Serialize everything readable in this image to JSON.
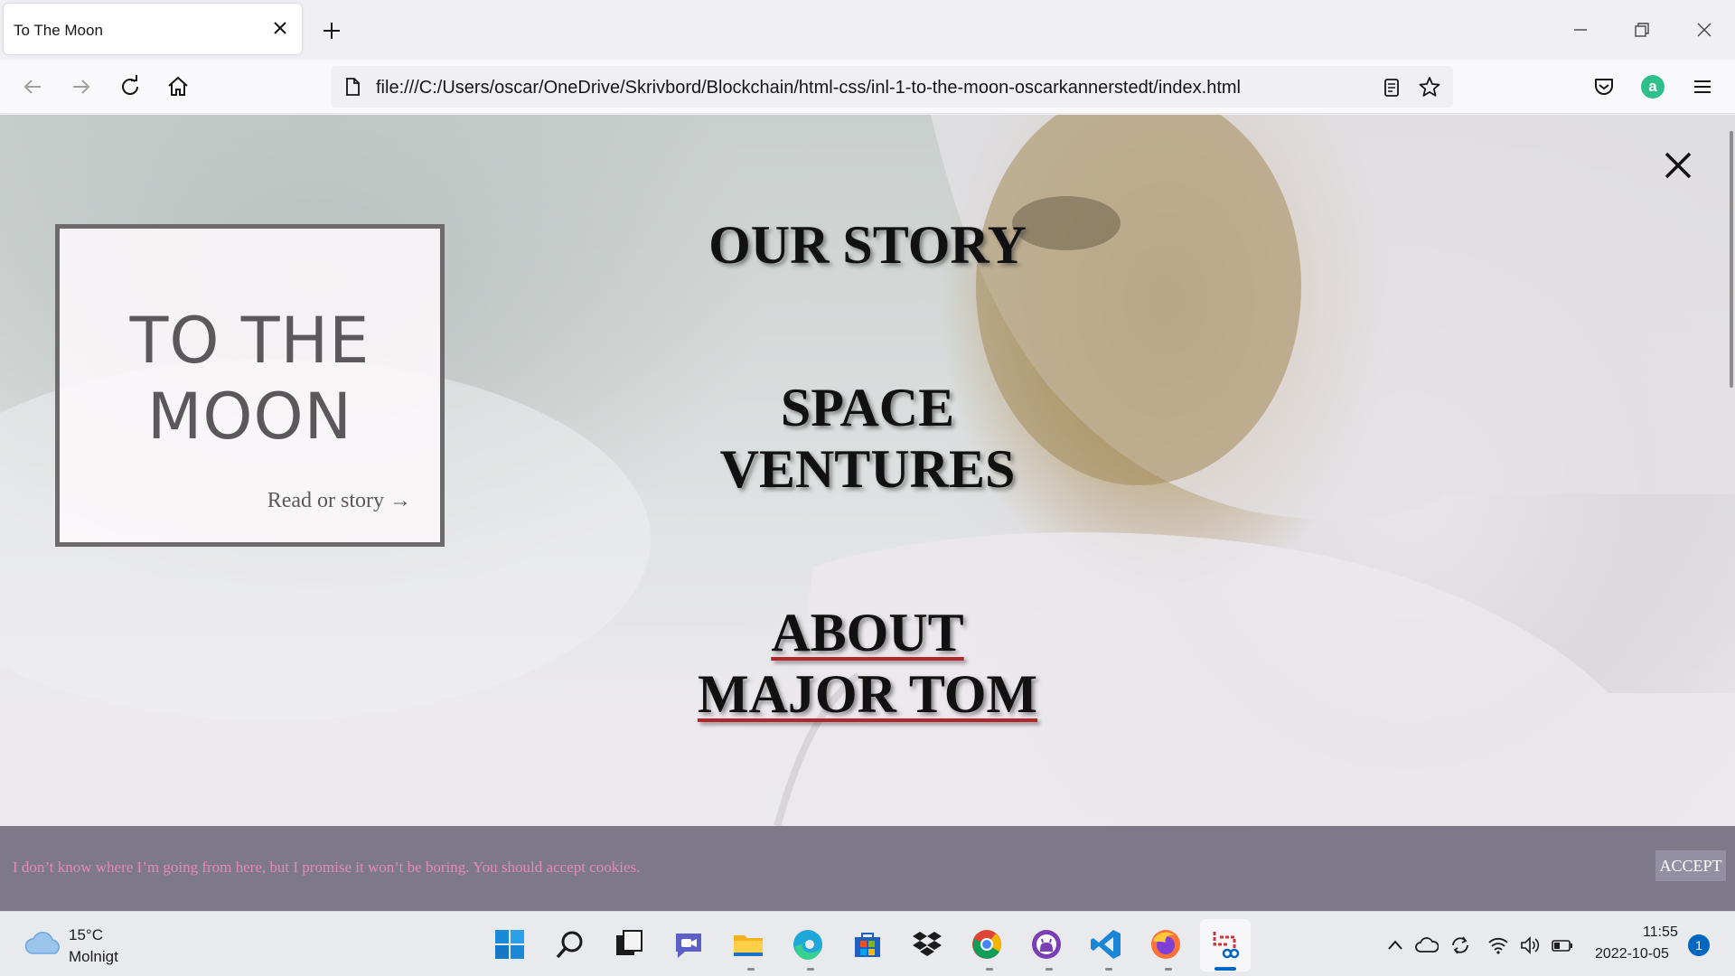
{
  "browser": {
    "tab_title": "To The Moon",
    "url": "file:///C:/Users/oscar/OneDrive/Skrivbord/Blockchain/html-css/inl-1-to-the-moon-oscarkannerstedt/index.html",
    "account_letter": "a"
  },
  "page": {
    "hero": {
      "title_line1": "TO THE",
      "title_line2": "MOON",
      "link": "Read or story →"
    },
    "menu": {
      "story": "OUR STORY",
      "space_line1": "SPACE",
      "space_line2": "VENTURES",
      "about_line1": "ABOUT",
      "about_line2": "MAJOR TOM"
    },
    "cookie": {
      "text": "I don’t know where I’m going from here, but I promise it won’t be boring. You should accept cookies.",
      "accept_label": "ACCEPT"
    }
  },
  "taskbar": {
    "weather_temp": "15°C",
    "weather_desc": "Molnigt",
    "time": "11:55",
    "date": "2022-10-05",
    "notifications": "1",
    "apps": [
      "start",
      "search",
      "task-view",
      "teams-chat",
      "file-explorer",
      "edge",
      "store",
      "dropbox",
      "chrome",
      "github-desktop",
      "vscode",
      "firefox",
      "snipping-tool"
    ]
  },
  "colors": {
    "accent_underline": "#b3262a",
    "cookie_bg": "#7d7989",
    "cookie_text": "#e48ab8"
  }
}
